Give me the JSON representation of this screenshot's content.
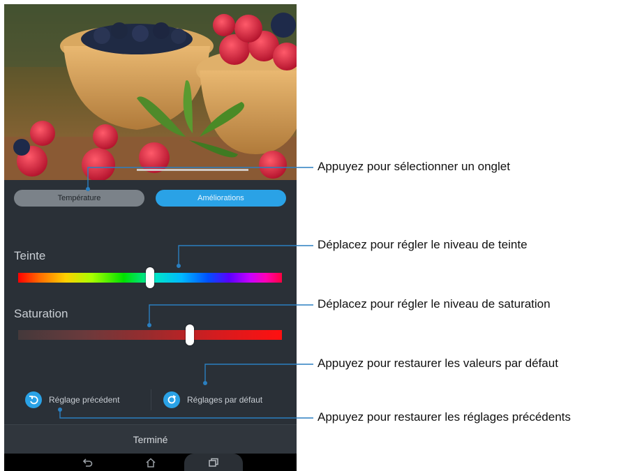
{
  "tabs": {
    "temperature": "Température",
    "enhancements": "Améliorations",
    "active": "enhancements"
  },
  "hue": {
    "label": "Teinte",
    "value": 0.5
  },
  "saturation": {
    "label": "Saturation",
    "value": 0.65
  },
  "actions": {
    "previous": "Réglage précédent",
    "default": "Réglages par défaut"
  },
  "done_label": "Terminé",
  "callouts": {
    "tab": "Appuyez pour sélectionner un onglet",
    "hue": "Déplacez pour régler le niveau de teinte",
    "saturation": "Déplacez pour régler le niveau de saturation",
    "default": "Appuyez pour restaurer les valeurs par défaut",
    "previous": "Appuyez pour restaurer les réglages précédents"
  },
  "colors": {
    "accent": "#2aa2e6",
    "panel": "#2a3037",
    "callout_line": "#2a7fc0"
  },
  "icons": {
    "previous": "undo-circle-icon",
    "default": "refresh-circle-icon",
    "back": "back-icon",
    "home": "home-icon",
    "recents": "recents-icon"
  }
}
